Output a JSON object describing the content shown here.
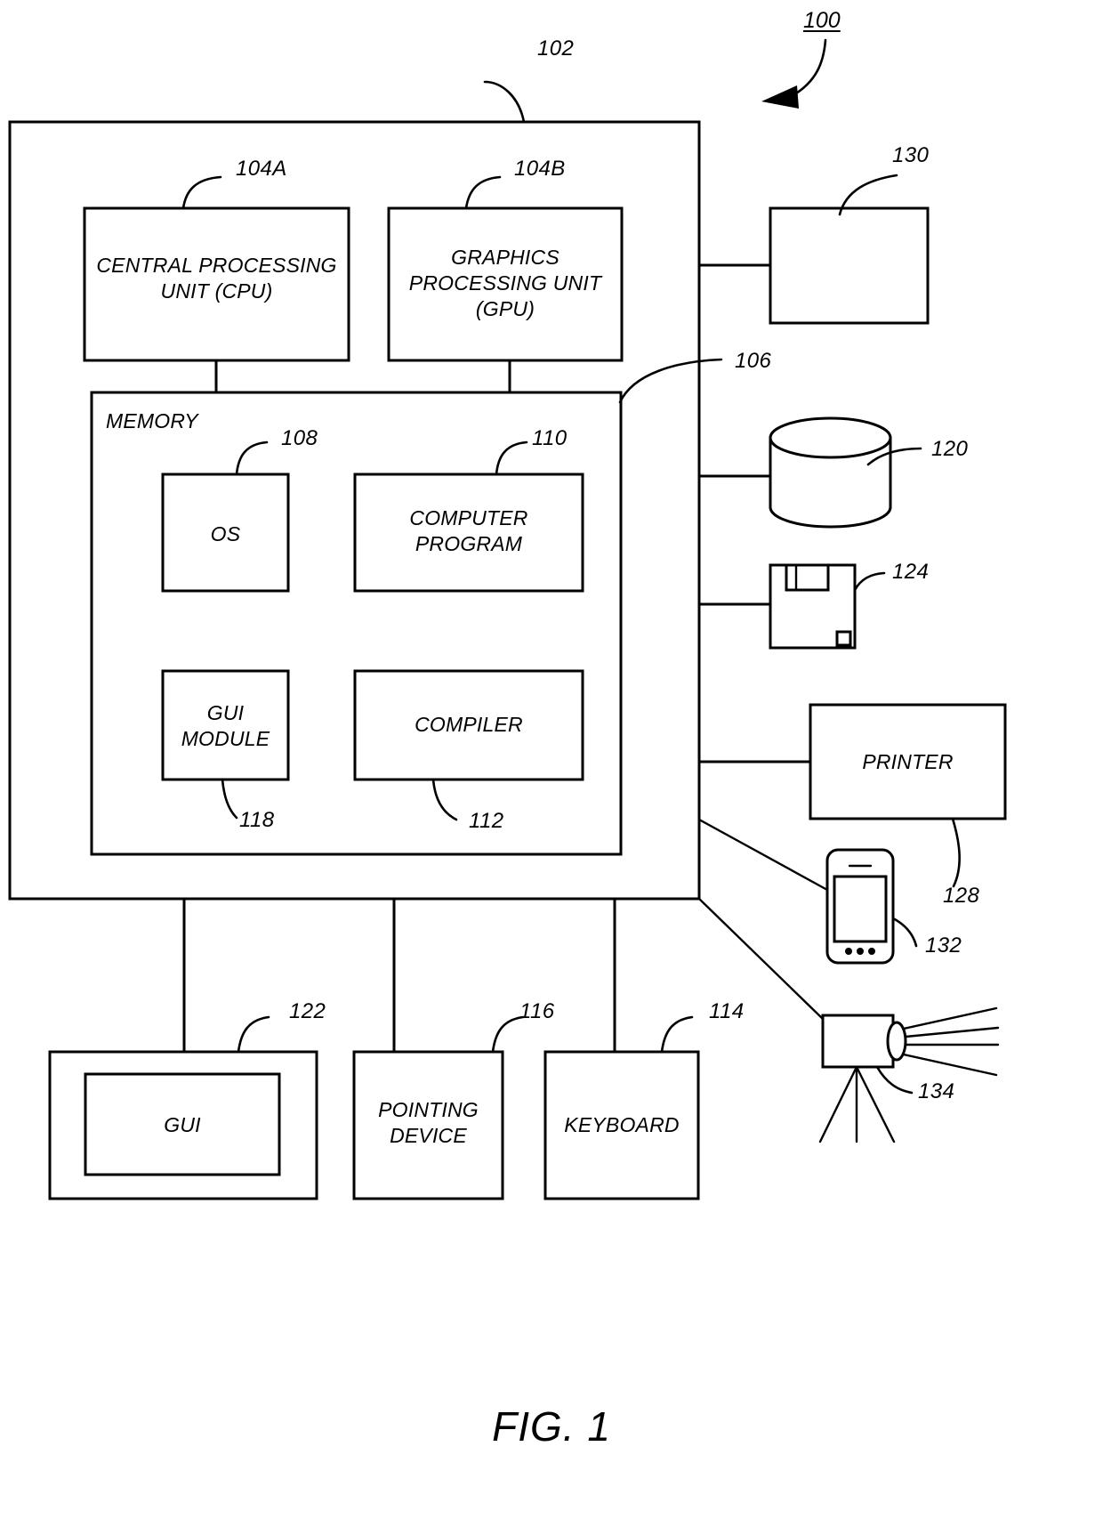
{
  "figure": {
    "caption": "FIG. 1",
    "system_ref": "100"
  },
  "reference_numerals": {
    "system": "100",
    "computer": "102",
    "cpu": "104A",
    "gpu": "104B",
    "memory": "106",
    "os": "108",
    "computer_program": "110",
    "compiler": "112",
    "keyboard": "114",
    "pointing_device": "116",
    "gui_module": "118",
    "data_storage": "120",
    "gui_display": "122",
    "removable_media": "124",
    "printer": "128",
    "monitor": "130",
    "mobile_device": "132",
    "camera": "134"
  },
  "blocks": {
    "cpu": {
      "label": "CENTRAL PROCESSING\nUNIT (CPU)",
      "ref": "104A"
    },
    "gpu": {
      "label": "GRAPHICS\nPROCESSING UNIT\n(GPU)",
      "ref": "104B"
    },
    "memory": {
      "label": "MEMORY",
      "ref": "106"
    },
    "os": {
      "label": "OS",
      "ref": "108"
    },
    "computer_program": {
      "label": "COMPUTER\nPROGRAM",
      "ref": "110"
    },
    "gui_module": {
      "label": "GUI\nMODULE",
      "ref": "118"
    },
    "compiler": {
      "label": "COMPILER",
      "ref": "112"
    },
    "gui": {
      "label": "GUI",
      "ref": "122"
    },
    "pointing_device": {
      "label": "POINTING\nDEVICE",
      "ref": "116"
    },
    "keyboard": {
      "label": "KEYBOARD",
      "ref": "114"
    },
    "printer": {
      "label": "PRINTER",
      "ref": "128"
    },
    "monitor": {
      "label": "",
      "ref": "130"
    },
    "data_storage": {
      "label": "",
      "ref": "120"
    },
    "removable_media": {
      "label": "",
      "ref": "124"
    },
    "mobile_device": {
      "label": "",
      "ref": "132"
    },
    "camera": {
      "label": "",
      "ref": "134"
    },
    "computer": {
      "label": "",
      "ref": "102"
    }
  },
  "icons": {
    "monitor": "display-icon",
    "data_storage": "database-cylinder-icon",
    "removable_media": "floppy-disk-icon",
    "mobile_device": "smartphone-icon",
    "camera": "camera-on-tripod-icon",
    "system_arrow": "curved-arrow-icon"
  }
}
